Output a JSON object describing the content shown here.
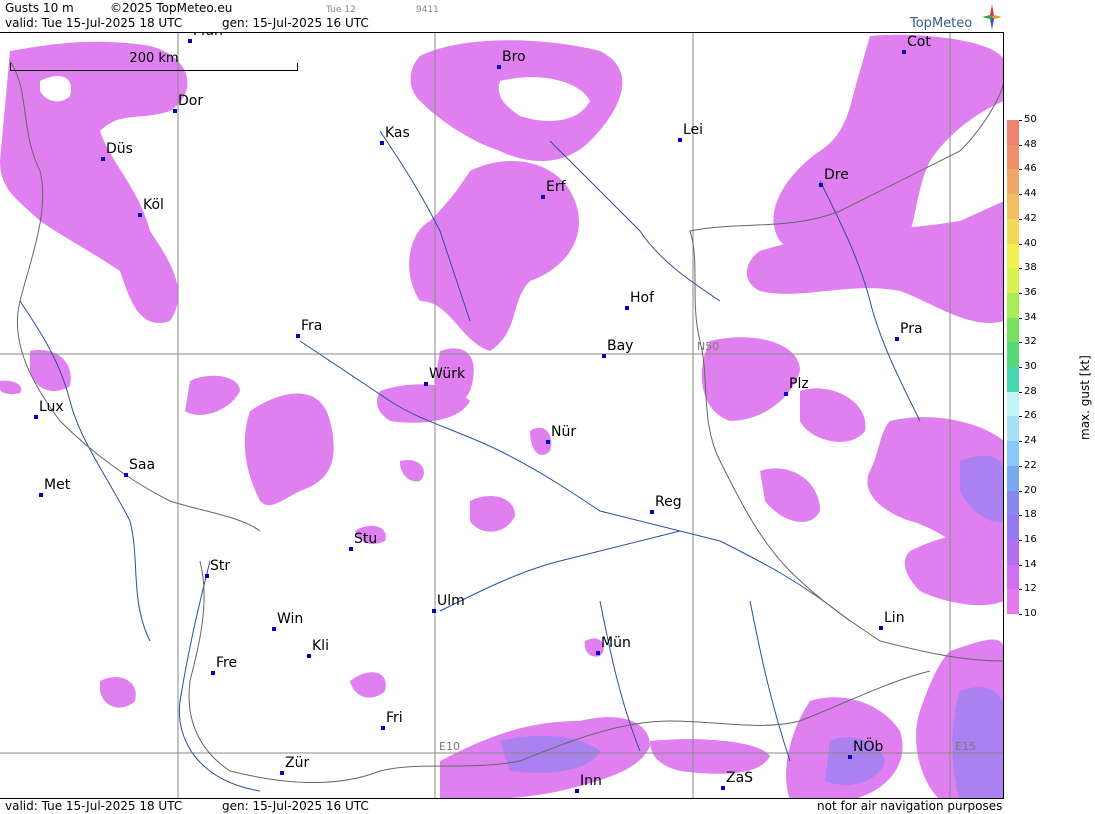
{
  "header": {
    "product": "Gusts 10 m",
    "copyright": "©2025 TopMeteo.eu",
    "tag_time": "Tue 12",
    "tag_code": "9411",
    "valid": "valid:  Tue  15-Jul-2025  18 UTC",
    "gen": "gen: 15-Jul-2025 16 UTC"
  },
  "logo": {
    "text": "TopMeteo",
    "icon": "compass-star-icon"
  },
  "scale": {
    "label": "200 km"
  },
  "grid_labels": {
    "n50": "N50",
    "e10": "E10",
    "e15": "E15"
  },
  "cities": [
    {
      "name": "Mün",
      "id": "muenster"
    },
    {
      "name": "Dor",
      "id": "dortmund"
    },
    {
      "name": "Düs",
      "id": "duesseldorf"
    },
    {
      "name": "Köl",
      "id": "koeln"
    },
    {
      "name": "Kas",
      "id": "kassel"
    },
    {
      "name": "Bro",
      "id": "brocken"
    },
    {
      "name": "Lei",
      "id": "leipzig"
    },
    {
      "name": "Cot",
      "id": "cottbus"
    },
    {
      "name": "Erf",
      "id": "erfurt"
    },
    {
      "name": "Dre",
      "id": "dresden"
    },
    {
      "name": "Hof",
      "id": "hof"
    },
    {
      "name": "Fra",
      "id": "frankfurt"
    },
    {
      "name": "Pra",
      "id": "praha"
    },
    {
      "name": "Bay",
      "id": "bayreuth"
    },
    {
      "name": "Würk",
      "id": "wuerzburg"
    },
    {
      "name": "Plz",
      "id": "plzen"
    },
    {
      "name": "Lux",
      "id": "luxembourg"
    },
    {
      "name": "Nür",
      "id": "nuernberg"
    },
    {
      "name": "Saa",
      "id": "saarbruecken"
    },
    {
      "name": "Met",
      "id": "metz"
    },
    {
      "name": "Reg",
      "id": "regensburg"
    },
    {
      "name": "Stu",
      "id": "stuttgart"
    },
    {
      "name": "Str",
      "id": "strasbourg"
    },
    {
      "name": "Ulm",
      "id": "ulm"
    },
    {
      "name": "Win",
      "id": "winterberg"
    },
    {
      "name": "Kli",
      "id": "klippeneck"
    },
    {
      "name": "Mün",
      "id": "muenchen"
    },
    {
      "name": "Lin",
      "id": "linz"
    },
    {
      "name": "Fre",
      "id": "freiburg"
    },
    {
      "name": "Fri",
      "id": "friedrichshafen"
    },
    {
      "name": "NÖb",
      "id": "noeb"
    },
    {
      "name": "Zür",
      "id": "zuerich"
    },
    {
      "name": "Inn",
      "id": "innsbruck"
    },
    {
      "name": "ZaS",
      "id": "zellamsee"
    }
  ],
  "legend": {
    "title": "max. gust [kt]",
    "ticks": [
      "50",
      "48",
      "46",
      "44",
      "42",
      "40",
      "38",
      "36",
      "34",
      "32",
      "30",
      "28",
      "26",
      "24",
      "22",
      "20",
      "18",
      "16",
      "14",
      "12",
      "10"
    ],
    "colors": [
      "#f08070",
      "#f0906a",
      "#f0a868",
      "#f0c060",
      "#f0d858",
      "#f0f050",
      "#d8f050",
      "#a8ec58",
      "#78e060",
      "#58d878",
      "#48d8b0",
      "#c0f4f8",
      "#a8e0f8",
      "#88c8f8",
      "#78a8f0",
      "#8888f0",
      "#9878f0",
      "#b070f0",
      "#d070f0",
      "#e878f0"
    ]
  },
  "footer": {
    "valid": "valid:  Tue  15-Jul-2025  18 UTC",
    "gen": "gen: 15-Jul-2025 16 UTC",
    "disclaimer": "not for air navigation purposes"
  }
}
